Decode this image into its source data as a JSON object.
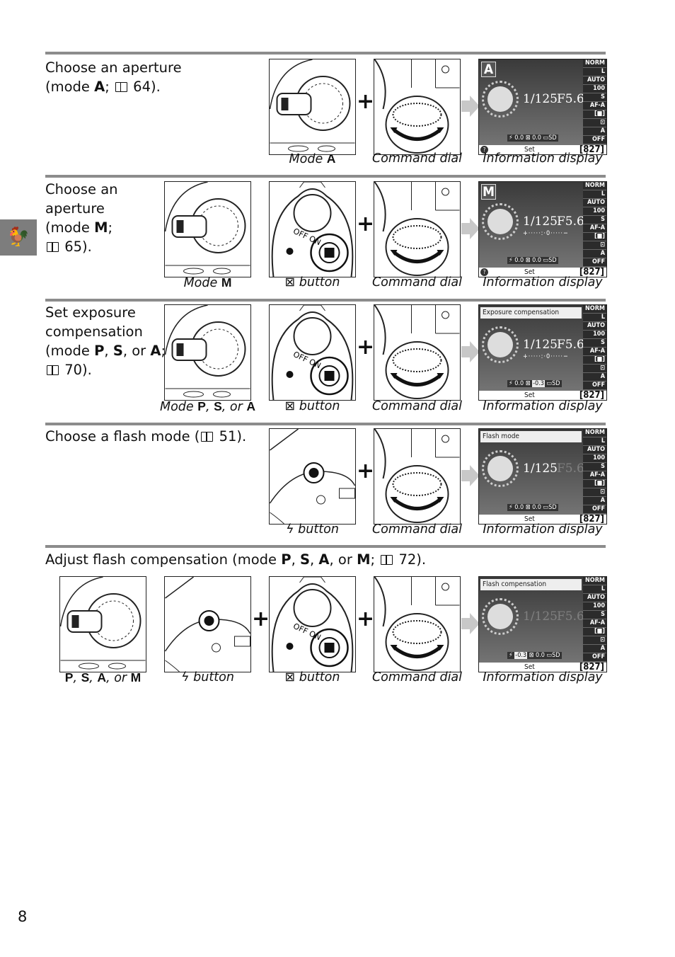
{
  "side_tab": {
    "icon": "rooster-icon",
    "glyph": "🐓"
  },
  "page_number": "8",
  "info_common": {
    "quality": "NORM",
    "size": "L",
    "wb": "AUTO",
    "iso": "100",
    "release": "S",
    "af": "AF-A",
    "area": "[■]",
    "meter": "⊡",
    "adl": "A",
    "bkt": "OFF",
    "shutter": "1/125",
    "aperture": "F5.6",
    "card": "SD",
    "set": "Set",
    "count": "[827]",
    "auto": "AUTO"
  },
  "rows": [
    {
      "title": [
        {
          "t": "Choose an aperture"
        },
        {
          "br": true
        },
        {
          "t": "(mode "
        },
        {
          "b": "A"
        },
        {
          "t": "; "
        },
        {
          "ref": true
        },
        {
          "t": " 64)."
        }
      ],
      "items": [
        {
          "kind": "dial-mode",
          "caption": [
            {
              "t": "Mode "
            },
            {
              "b": "A"
            }
          ]
        },
        {
          "kind": "command-dial",
          "caption": [
            {
              "t": "Command dial"
            }
          ]
        },
        {
          "kind": "info",
          "mode": "A",
          "exp": "0.0",
          "flash": "0.0",
          "caption": [
            {
              "t": "Information display"
            }
          ]
        }
      ]
    },
    {
      "title": [
        {
          "t": "Choose an"
        },
        {
          "br": true
        },
        {
          "t": "aperture"
        },
        {
          "br": true
        },
        {
          "t": "(mode "
        },
        {
          "b": "M"
        },
        {
          "t": ";"
        },
        {
          "br": true
        },
        {
          "ref": true
        },
        {
          "t": " 65)."
        }
      ],
      "items": [
        {
          "kind": "dial-mode",
          "caption": [
            {
              "t": "Mode "
            },
            {
              "b": "M"
            }
          ]
        },
        {
          "kind": "exp-button",
          "caption": [
            {
              "t": "⊠ button"
            }
          ]
        },
        {
          "kind": "command-dial",
          "caption": [
            {
              "t": "Command dial"
            }
          ]
        },
        {
          "kind": "info",
          "mode": "M",
          "exp": "0.0",
          "flash": "0.0",
          "scale": "+·····:·0·····−",
          "caption": [
            {
              "t": "Information display"
            }
          ]
        }
      ]
    },
    {
      "title": [
        {
          "t": "Set exposure"
        },
        {
          "br": true
        },
        {
          "t": "compensation"
        },
        {
          "br": true
        },
        {
          "t": "(mode "
        },
        {
          "b": "P"
        },
        {
          "t": ", "
        },
        {
          "b": "S"
        },
        {
          "t": ", or "
        },
        {
          "b": "A"
        },
        {
          "t": ";"
        },
        {
          "br": true
        },
        {
          "ref": true
        },
        {
          "t": " 70)."
        }
      ],
      "items": [
        {
          "kind": "dial-mode",
          "caption": [
            {
              "t": "Mode "
            },
            {
              "b": "P"
            },
            {
              "t": ", "
            },
            {
              "b": "S"
            },
            {
              "t": ", or "
            },
            {
              "b": "A"
            }
          ]
        },
        {
          "kind": "exp-button",
          "caption": [
            {
              "t": "⊠ button"
            }
          ]
        },
        {
          "kind": "command-dial",
          "caption": [
            {
              "t": "Command dial"
            }
          ]
        },
        {
          "kind": "info",
          "banner": "Exposure compensation",
          "exp": "-0.3",
          "flash": "0.0",
          "scale": "+·····:·0·····−",
          "caption": [
            {
              "t": "Information display"
            }
          ]
        }
      ]
    },
    {
      "title": [
        {
          "t": "Choose a flash mode ("
        },
        {
          "ref": true
        },
        {
          "t": " 51)."
        }
      ],
      "items": [
        {
          "kind": "flash-button",
          "caption": [
            {
              "t": "ϟ button"
            }
          ]
        },
        {
          "kind": "command-dial",
          "caption": [
            {
              "t": "Command dial"
            }
          ]
        },
        {
          "kind": "info",
          "banner": "Flash mode",
          "exp": "0.0",
          "flash": "0.0",
          "dimAperture": true,
          "caption": [
            {
              "t": "Information display"
            }
          ]
        }
      ]
    },
    {
      "title": [
        {
          "t": "Adjust flash compensation (mode "
        },
        {
          "b": "P"
        },
        {
          "t": ", "
        },
        {
          "b": "S"
        },
        {
          "t": ", "
        },
        {
          "b": "A"
        },
        {
          "t": ", or "
        },
        {
          "b": "M"
        },
        {
          "t": "; "
        },
        {
          "ref": true
        },
        {
          "t": " 72)."
        }
      ],
      "items": [
        {
          "kind": "dial-mode",
          "caption": [
            {
              "b": "P"
            },
            {
              "t": ", "
            },
            {
              "b": "S"
            },
            {
              "t": ", "
            },
            {
              "b": "A"
            },
            {
              "t": ", or "
            },
            {
              "b": "M"
            }
          ]
        },
        {
          "kind": "flash-button",
          "caption": [
            {
              "t": "ϟ button"
            }
          ]
        },
        {
          "kind": "exp-button",
          "caption": [
            {
              "t": "⊠ button"
            }
          ]
        },
        {
          "kind": "command-dial",
          "caption": [
            {
              "t": "Command dial"
            }
          ]
        },
        {
          "kind": "info",
          "banner": "Flash compensation",
          "exp": "0.0",
          "flash": "-0.3",
          "dimAll": true,
          "caption": [
            {
              "t": "Information display"
            }
          ]
        }
      ]
    }
  ]
}
